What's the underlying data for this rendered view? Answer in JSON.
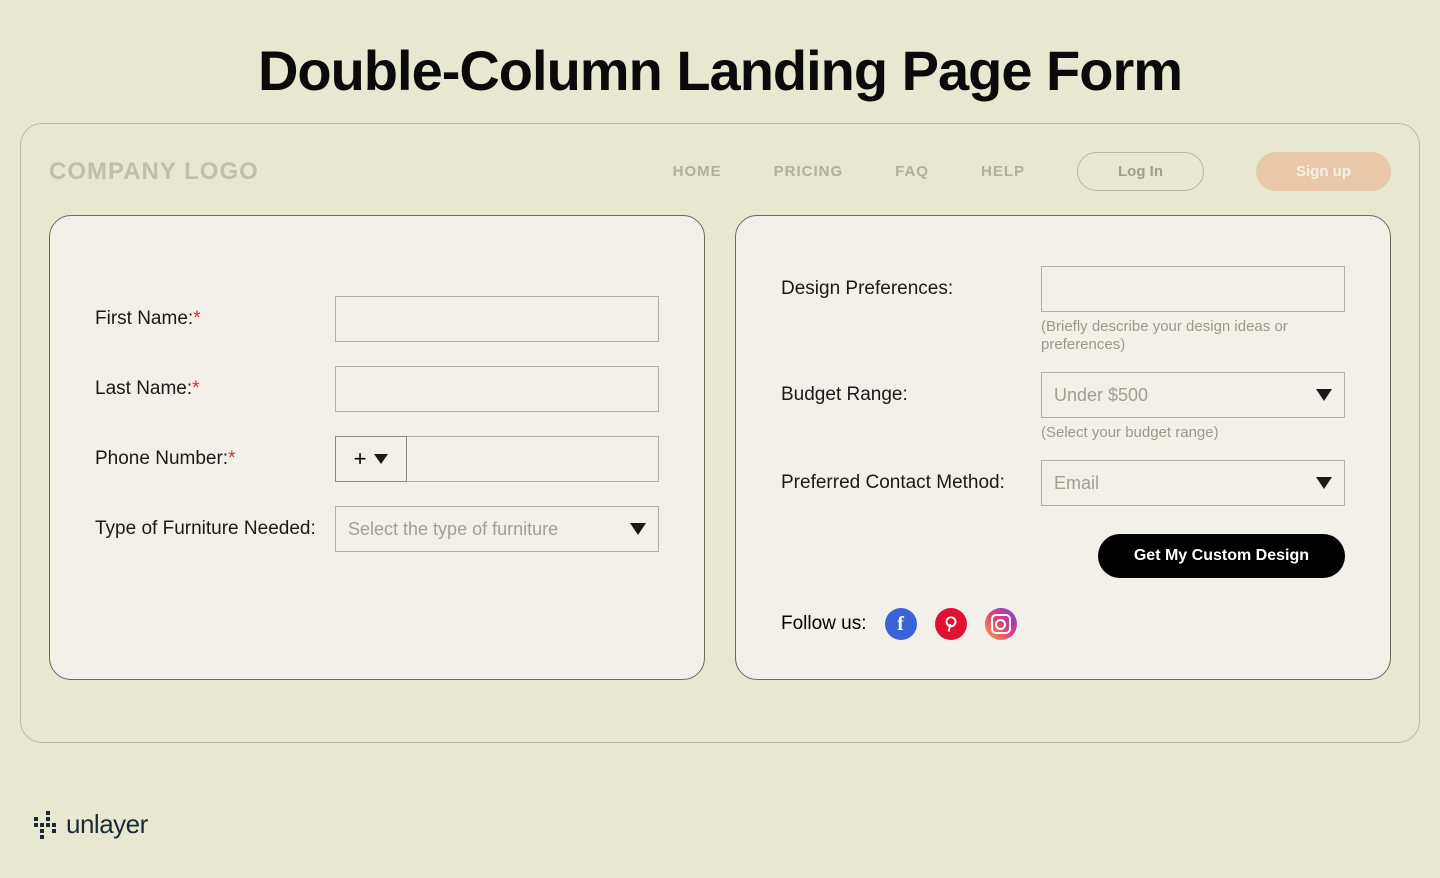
{
  "page": {
    "title": "Double-Column Landing Page Form"
  },
  "navbar": {
    "logo": "COMPANY LOGO",
    "links": [
      "HOME",
      "PRICING",
      "FAQ",
      "HELP"
    ],
    "login": "Log In",
    "signup": "Sign up"
  },
  "left": {
    "first_name_label": "First Name:",
    "last_name_label": "Last Name:",
    "phone_label": "Phone Number:",
    "phone_prefix": "+",
    "furniture_label": "Type of Furniture Needed:",
    "furniture_placeholder": "Select the type of furniture",
    "required_mark": "*"
  },
  "right": {
    "design_label": "Design Preferences:",
    "design_hint": "(Briefly describe your design ideas or preferences)",
    "budget_label": "Budget Range:",
    "budget_value": "Under $500",
    "budget_hint": "(Select your budget range)",
    "contact_label": "Preferred Contact Method:",
    "contact_value": "Email",
    "submit": "Get My Custom Design",
    "follow_label": "Follow us:"
  },
  "footer": {
    "brand": "unlayer"
  }
}
